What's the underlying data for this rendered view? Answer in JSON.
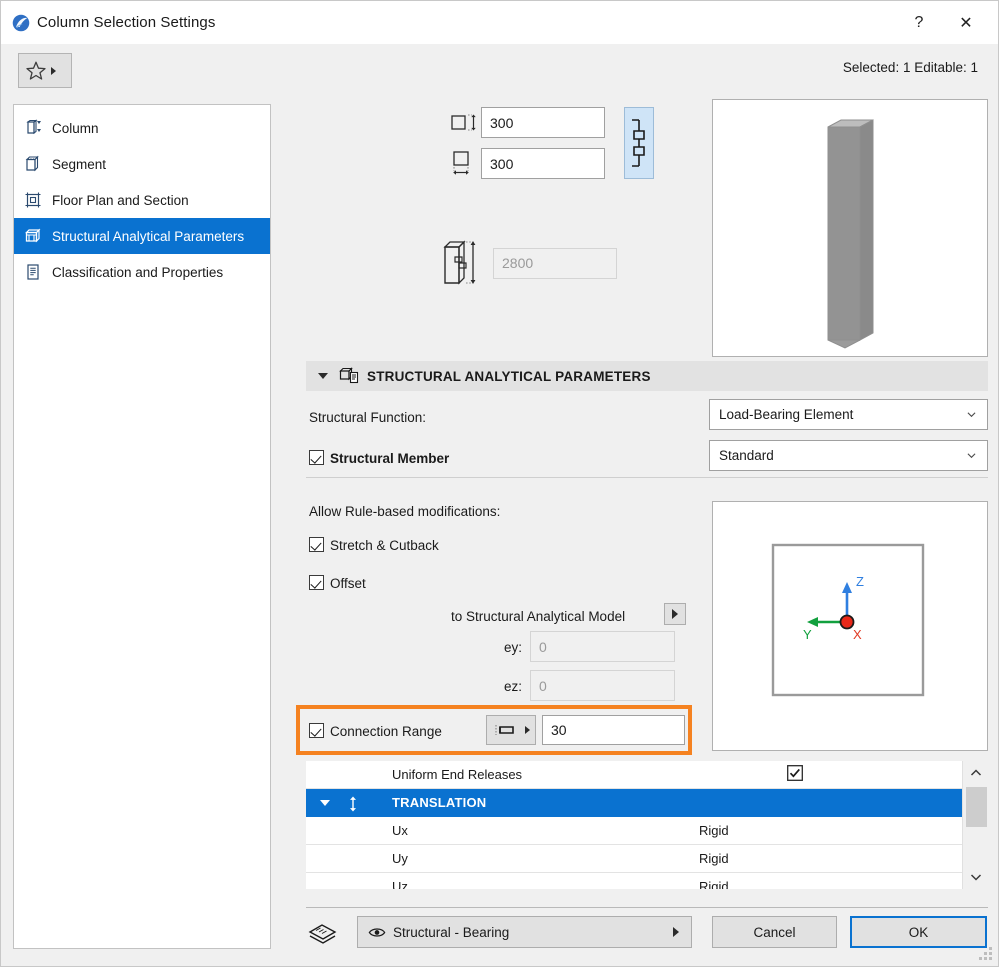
{
  "window": {
    "title": "Column Selection Settings",
    "help_label": "?",
    "close_label": "✕",
    "icon": "archicad-logo-icon"
  },
  "favbar": {
    "favorites_icon": "star-icon",
    "favorites_arrow_icon": "caret-right-icon",
    "selection_status": "Selected: 1 Editable: 1"
  },
  "sidebar": {
    "items": [
      {
        "label": "Column",
        "icon": "column-icon",
        "active": false
      },
      {
        "label": "Segment",
        "icon": "segment-icon",
        "active": false
      },
      {
        "label": "Floor Plan and Section",
        "icon": "floor-plan-section-icon",
        "active": false
      },
      {
        "label": "Structural Analytical Parameters",
        "icon": "structural-analytical-icon",
        "active": true
      },
      {
        "label": "Classification and Properties",
        "icon": "classification-properties-icon",
        "active": false
      }
    ]
  },
  "geometry": {
    "depth": {
      "icon": "column-depth-icon",
      "value": "300"
    },
    "width": {
      "icon": "column-width-icon",
      "value": "300"
    },
    "height": {
      "icon": "column-height-icon",
      "value": "2800",
      "disabled": true
    },
    "link_icon": "chain-link-icon",
    "link_active": true,
    "preview_icon": "column-3d-preview"
  },
  "section": {
    "caret_icon": "caret-down-icon",
    "icon": "structural-analytical-icon",
    "title": "STRUCTURAL ANALYTICAL PARAMETERS",
    "structural_function_label": "Structural Function:",
    "structural_function_value": "Load-Bearing Element",
    "structural_member_label": "Structural Member",
    "structural_member_checked": true,
    "structural_member_type_value": "Standard",
    "allow_rules_label": "Allow Rule-based modifications:",
    "stretch_cutback_label": "Stretch & Cutback",
    "stretch_cutback_checked": true,
    "offset_label": "Offset",
    "offset_checked": true,
    "to_model_label": "to Structural Analytical Model",
    "to_model_arrow_icon": "caret-right-icon",
    "ey_label": "ey:",
    "ey_value": "0",
    "ez_label": "ez:",
    "ez_value": "0",
    "connection_range_label": "Connection Range",
    "connection_range_checked": true,
    "connection_range_icon": "connection-range-icon",
    "connection_range_arrow_icon": "caret-right-icon",
    "connection_range_value": "30"
  },
  "axis_preview": {
    "z_label": "Z",
    "y_label": "Y",
    "x_label": "X",
    "z_color": "#2f7fe0",
    "y_color": "#12a03e",
    "x_color": "#e03a24",
    "origin_color": "#e8281a"
  },
  "releases_table": {
    "rows": [
      {
        "name": "Uniform End Releases",
        "value": "",
        "type": "check",
        "checked": true,
        "selected": false
      },
      {
        "name": "TRANSLATION",
        "value": "",
        "type": "group",
        "selected": true,
        "icon": "translation-arrow-icon"
      },
      {
        "name": "Ux",
        "value": "Rigid",
        "type": "data",
        "selected": false
      },
      {
        "name": "Uy",
        "value": "Rigid",
        "type": "data",
        "selected": false
      },
      {
        "name": "Uz",
        "value": "Rigid",
        "type": "data",
        "selected": false
      }
    ],
    "scroll_up_icon": "chevron-up-icon",
    "scroll_down_icon": "chevron-down-icon"
  },
  "footer": {
    "layers_icon": "layers-icon",
    "layer_eye_icon": "eye-icon",
    "layer_value": "Structural - Bearing",
    "layer_arrow_icon": "caret-right-icon",
    "cancel_label": "Cancel",
    "ok_label": "OK"
  },
  "colors": {
    "accent": "#0a72d0",
    "highlight": "#f58220",
    "window_bg": "#f0f0f0"
  }
}
